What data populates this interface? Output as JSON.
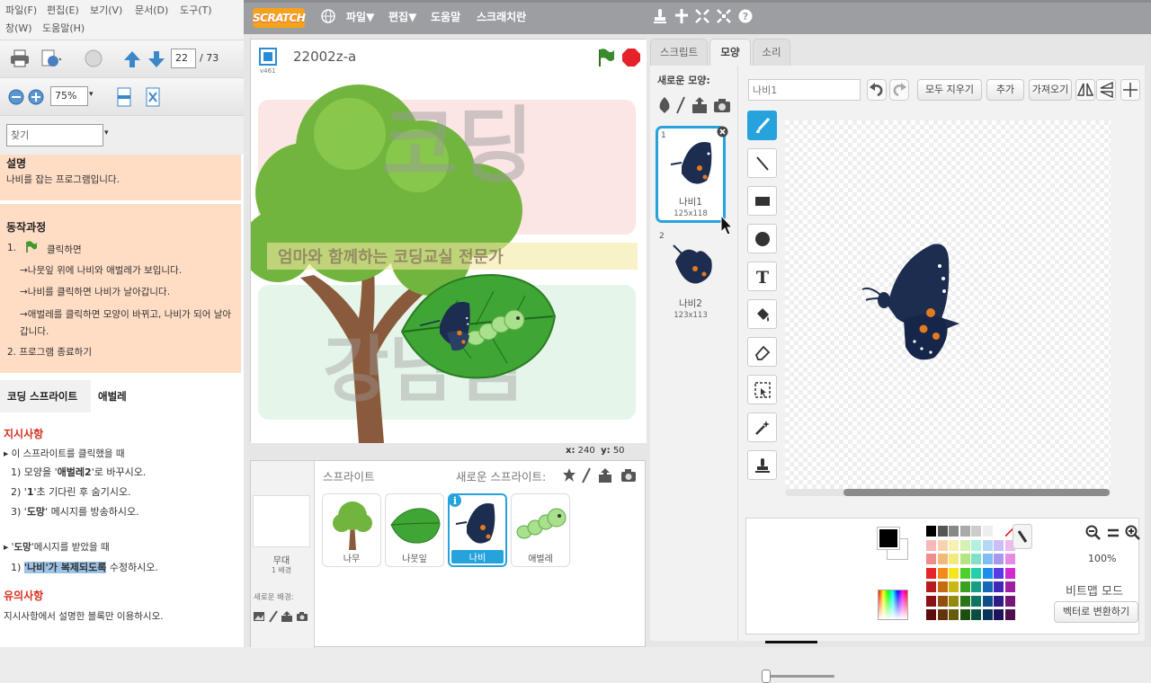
{
  "pdf_viewer": {
    "menu": {
      "file": "파일(F)",
      "edit": "편집(E)",
      "view": "보기(V)",
      "document": "문서(D)",
      "tools": "도구(T)",
      "window": "창(W)",
      "help": "도움말(H)"
    },
    "page_current": "22",
    "page_total": "/ 73",
    "zoom": "75%",
    "search_placeholder": "찾기",
    "doc": {
      "desc_title": "설명",
      "desc_text": "나비를 잡는 프로그램입니다.",
      "process_title": "동작과정",
      "step1_num": "1.",
      "step1_text": "클릭하면",
      "step1_sub1": "→나뭇잎 위에 나비와 애벌레가 보입니다.",
      "step1_sub2": "→나비를 클릭하면 나비가 날아갑니다.",
      "step1_sub3": "→애벌레를 클릭하면 모양이 바뀌고, 나비가 되어 날아갑니다.",
      "step2": "2.  프로그램 종료하기",
      "tab_coding_sprite": "코딩 스프라이트",
      "tab_caterpillar": "애벌레",
      "instructions_title": "지시사항",
      "inst1": "▸ 이 스프라이트를 클릭했을 때",
      "inst1_1_pre": "1) 모양을 '",
      "inst1_1_bold": "애벌레2",
      "inst1_1_post": "'로 바꾸시오.",
      "inst1_2_pre": "2) '",
      "inst1_2_bold": "1",
      "inst1_2_post": "'초 기다린 후 숨기시오.",
      "inst1_3_pre": "3) '",
      "inst1_3_bold": "도망",
      "inst1_3_post": "' 메시지를 방송하시오.",
      "inst2_pre": "▸ '",
      "inst2_bold": "도망",
      "inst2_post": "'메시지를 받았을 때",
      "inst2_1_num": "1) ",
      "inst2_1_hl": "'나비'가 복제되도록",
      "inst2_1_post": " 수정하시오.",
      "notes_title": "유의사항",
      "notes_text": "지시사항에서 설명한 블록만 이용하시오."
    }
  },
  "scratch": {
    "logo": "SCRATCH",
    "menu_file": "파일▼",
    "menu_edit": "편집▼",
    "menu_help": "도움말",
    "menu_tips": "스크래치란",
    "project_title": "22002z-a",
    "version": "v461",
    "coord_x_label": "x:",
    "coord_x": "240",
    "coord_y_label": "y:",
    "coord_y": "50",
    "sprites_label": "스프라이트",
    "new_sprite_label": "새로운 스프라이트:",
    "stage_name": "무대",
    "stage_bg_count": "1 배경",
    "new_backdrop_label": "새로운 배경:",
    "sprites": [
      "나무",
      "나뭇잎",
      "나비",
      "애벌레"
    ],
    "selected_sprite": "나비",
    "tabs": [
      "스크립트",
      "모양",
      "소리"
    ],
    "active_tab": "모양",
    "new_costume_label": "새로운 모양:",
    "costumes": [
      {
        "num": "1",
        "name": "나비1",
        "size": "125x118"
      },
      {
        "num": "2",
        "name": "나비2",
        "size": "123x113"
      }
    ],
    "costume_name_value": "나비1",
    "btn_clear": "모두 지우기",
    "btn_add": "추가",
    "btn_import": "가져오기",
    "zoom_percent": "100%",
    "mode_label": "비트맵 모드",
    "convert_button": "벡터로 변환하기",
    "watermark": {
      "title": "코딩",
      "subtitle": "엄마와 함께하는 코딩교실 전문가",
      "bottom": "강남쌤"
    },
    "colors": {
      "topbar": "#9c9ea2",
      "selection_blue": "#27a3dc",
      "butterfly_navy": "#1d2d4f",
      "butterfly_orange": "#e27b1f",
      "flag_green": "#3a8b2c",
      "stop_red": "#e5222b"
    }
  }
}
